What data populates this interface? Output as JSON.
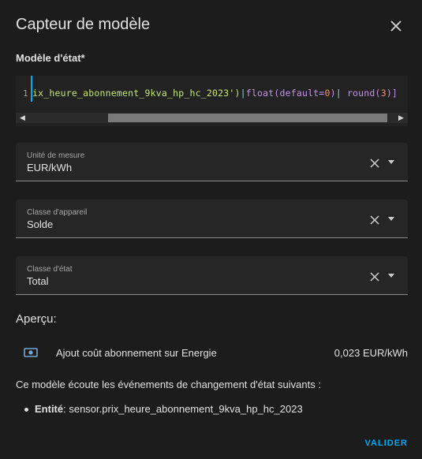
{
  "dialog": {
    "title": "Capteur de modèle",
    "close_icon": "close-icon"
  },
  "template": {
    "label": "Modèle d'état*",
    "line_number": "1",
    "code": {
      "tok_str": "ix_heure_abonnement_9kva_hp_hc_2023')",
      "tok_pipe1": "|",
      "tok_fn1": "float(default=",
      "tok_num1": "0",
      "tok_close1": ")",
      "tok_pipe2": "|",
      "tok_space": " ",
      "tok_fn2": "round(",
      "tok_num2": "3",
      "tok_close2": ")]"
    }
  },
  "fields": {
    "unit": {
      "label": "Unité de mesure",
      "value": "EUR/kWh"
    },
    "device_class": {
      "label": "Classe d'appareil",
      "value": "Solde"
    },
    "state_class": {
      "label": "Classe d'état",
      "value": "Total"
    }
  },
  "preview": {
    "heading": "Aperçu:",
    "sensor_icon": "cash-icon",
    "sensor_name": "Ajout coût abonnement sur Energie",
    "sensor_value": "0,023 EUR/kWh"
  },
  "listeners": {
    "text": "Ce modèle écoute les événements de changement d'état suivants :",
    "entity_label": "Entité",
    "entity_value": ": sensor.prix_heure_abonnement_9kva_hp_hc_2023"
  },
  "actions": {
    "validate_label": "VALIDER"
  },
  "colors": {
    "background": "#1c1c1c",
    "accent": "#03a9f4",
    "field": "#262626"
  }
}
